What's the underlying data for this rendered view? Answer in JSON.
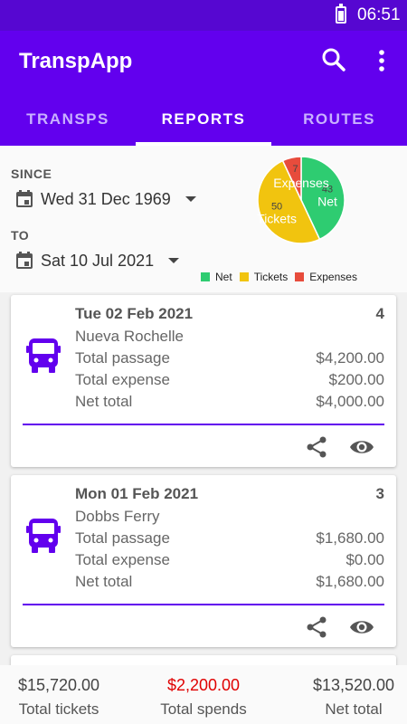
{
  "status_bar": {
    "time": "06:51"
  },
  "app": {
    "title": "TranspApp"
  },
  "tabs": [
    {
      "label": "TRANSPS"
    },
    {
      "label": "REPORTS"
    },
    {
      "label": "ROUTES"
    }
  ],
  "filters": {
    "since_label": "SINCE",
    "since_value": "Wed 31 Dec 1969",
    "to_label": "TO",
    "to_value": "Sat 10 Jul 2021"
  },
  "pie": {
    "slices": [
      {
        "name": "Net",
        "value": 43,
        "color": "#2ecc71"
      },
      {
        "name": "Tickets",
        "value": 50,
        "color": "#f1c40f"
      },
      {
        "name": "Expenses",
        "value": 7,
        "color": "#e74c3c"
      }
    ]
  },
  "cards": [
    {
      "date": "Tue 02 Feb 2021",
      "count": "4",
      "route": "Nueva Rochelle",
      "rows": [
        {
          "label": "Total passage",
          "value": "$4,200.00"
        },
        {
          "label": "Total expense",
          "value": "$200.00"
        },
        {
          "label": "Net total",
          "value": "$4,000.00"
        }
      ]
    },
    {
      "date": "Mon 01 Feb 2021",
      "count": "3",
      "route": "Dobbs Ferry",
      "rows": [
        {
          "label": "Total passage",
          "value": "$1,680.00"
        },
        {
          "label": "Total expense",
          "value": "$0.00"
        },
        {
          "label": "Net total",
          "value": "$1,680.00"
        }
      ]
    }
  ],
  "totals": {
    "tickets_value": "$15,720.00",
    "tickets_label": "Total tickets",
    "spends_value": "$2,200.00",
    "spends_label": "Total spends",
    "spends_color": "#e00000",
    "net_value": "$13,520.00",
    "net_label": "Net total"
  },
  "colors": {
    "primary": "#6200ee",
    "status_bar": "#5607d1"
  }
}
